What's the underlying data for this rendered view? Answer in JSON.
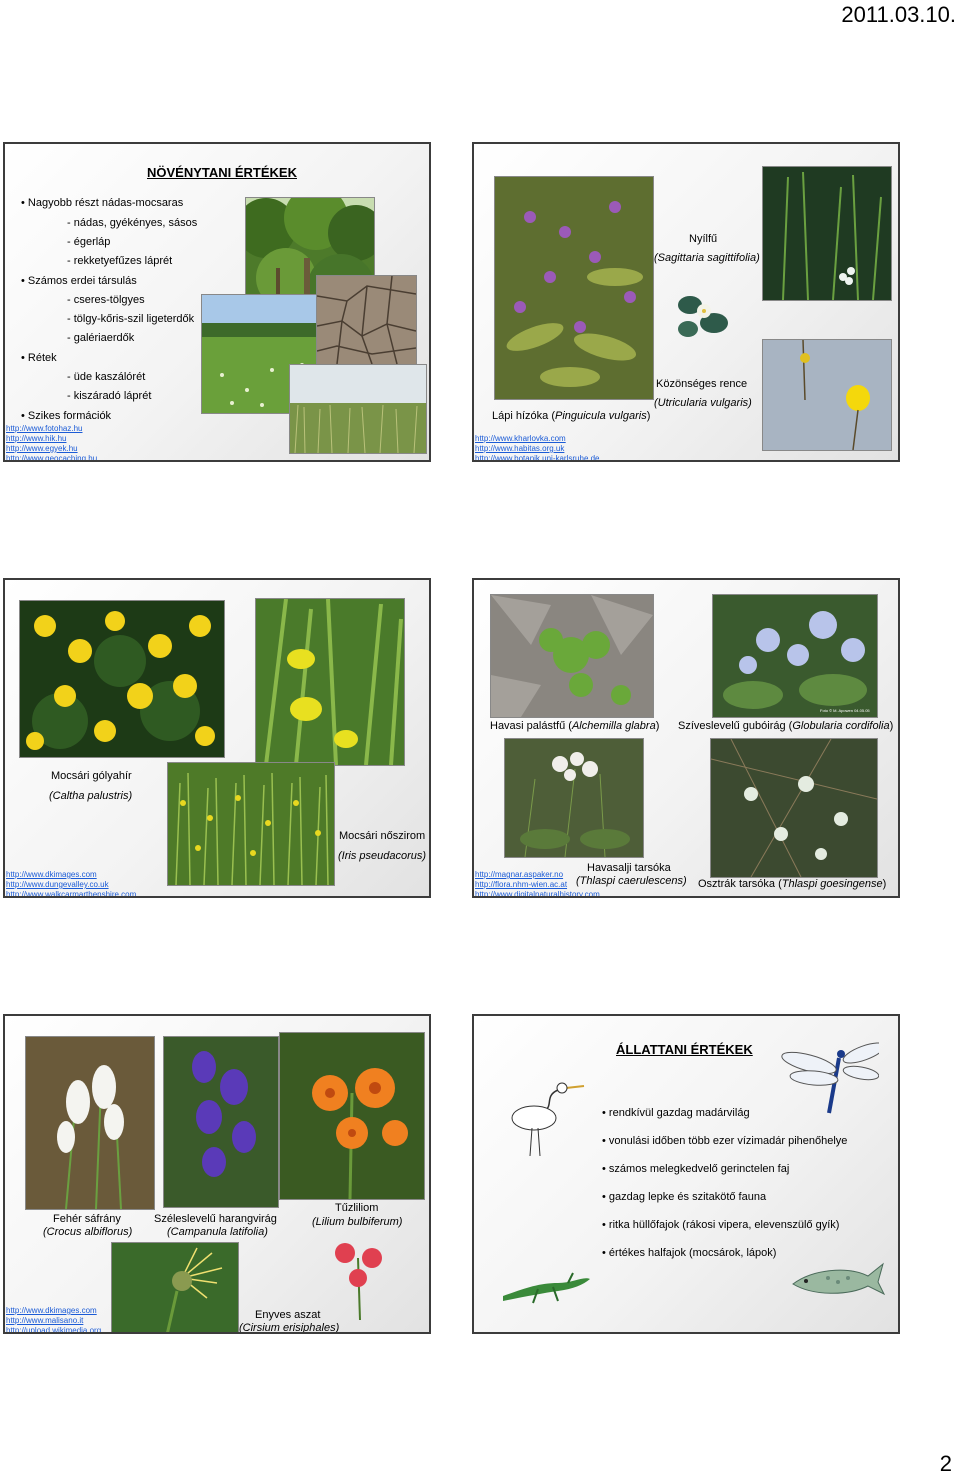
{
  "header": {
    "date": "2011.03.10."
  },
  "footer": {
    "page_number": "2"
  },
  "slide1": {
    "title": "NÖVÉNYTANI ÉRTÉKEK",
    "bullets": [
      "Nagyobb részt nádas-mocsaras",
      "- nádas, gyékényes, sásos",
      "- égerláp",
      "- rekketyefűzes láprét",
      "Számos erdei társulás",
      "- cseres-tölgyes",
      "- tölgy-kőris-szil ligeterdők",
      "- galériaerdők",
      "Rétek",
      "- üde kaszálórét",
      "- kiszáradó láprét",
      "Szikes formációk"
    ],
    "links": [
      "http://www.fotohaz.hu",
      "http://www.hik.hu",
      "http://www.egyek.hu",
      "http://www.geocaching.hu"
    ]
  },
  "slide2": {
    "nyilfu": "Nyílfű",
    "nyilfu_latin": "(Sagittaria sagittifolia)",
    "rence": "Közönséges rence",
    "rence_latin": "(Utricularia vulgaris)",
    "hizoka_pre": "Lápi hízóka (",
    "hizoka_latin": "Pinguicula vulgaris",
    "close": ")",
    "links": [
      "http://www.kharlovka.com",
      "http://www.habitas.org.uk",
      "http://www.botanik.uni-karlsruhe.de"
    ]
  },
  "slide3": {
    "golyahir": "Mocsári gólyahír",
    "golyahir_latin": "(Caltha palustris)",
    "noszirom": "Mocsári nőszirom",
    "noszirom_latin": "(Iris pseudacorus)",
    "links": [
      "http://www.dkimages.com",
      "http://www.dungevalley.co.uk",
      "http://www.walkcarmarthenshire.com"
    ]
  },
  "slide4": {
    "palast_pre": "Havasi palástfű (",
    "palast_latin": "Alchemilla glabra",
    "gubo_pre": "Szíveslevelű gubóirág (",
    "gubo_latin": "Globularia cordifolia",
    "close": ")",
    "tarsoka1": "Havasalji tarsóka",
    "tarsoka1_latin": "(Thlaspi caerulescens)",
    "tarsoka2_pre": "Osztrák tarsóka (",
    "tarsoka2_latin": "Thlaspi goesingense",
    "photo_credit": "Foto © M. Apowen 04.05.05",
    "links": [
      "http://magnar.aspaker.no",
      "http://flora.nhm-wien.ac.at",
      "http://www.digitalnaturalhistory.com"
    ]
  },
  "slide5": {
    "safrany": "Fehér sáfrány",
    "safrany_latin": "(Crocus albiflorus)",
    "harangvirag": "Széleslevelű harangvirág",
    "harangvirag_latin": "(Campanula latifolia)",
    "liliom": "Tűzliliom",
    "liliom_latin": "(Lilium bulbiferum)",
    "aszat": "Enyves aszat",
    "aszat_latin": "(Cirsium erisiphales)",
    "links": [
      "http://www.dkimages.com",
      "http://www.malisano.it",
      "http://upload.wikimedia.org"
    ]
  },
  "slide6": {
    "title": "ÁLLATTANI ÉRTÉKEK",
    "bullets": [
      "rendkívül gazdag madárvilág",
      "vonulási időben több ezer vízimadár pihenőhelye",
      "számos melegkedvelő gerinctelen faj",
      "gazdag lepke és szitakötő fauna",
      "ritka hüllőfajok (rákosi vipera, elevenszülő gyík)",
      "értékes halfajok (mocsárok, lápok)"
    ]
  },
  "colors": {
    "link": "#1b5bd6",
    "border": "#3c3c3c"
  }
}
